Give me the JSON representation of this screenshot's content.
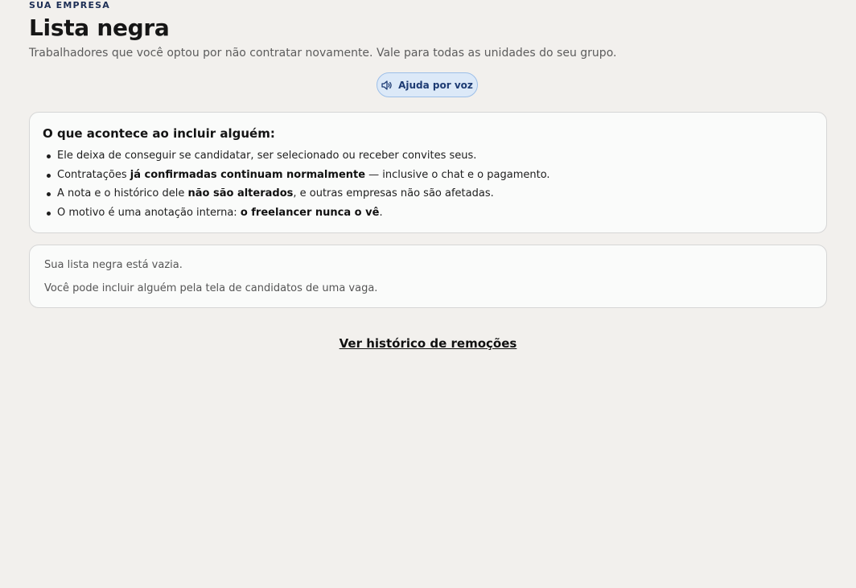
{
  "header": {
    "eyebrow": "SUA EMPRESA",
    "title": "Lista negra",
    "subtitle": "Trabalhadores que você optou por não contratar novamente. Vale para todas as unidades do seu grupo."
  },
  "voice_help": {
    "label": "Ajuda por voz",
    "icon": "speaker-icon"
  },
  "info_card": {
    "title": "O que acontece ao incluir alguém:",
    "items": [
      {
        "text": "Ele deixa de conseguir se candidatar, ser selecionado ou receber convites seus."
      },
      {
        "pre": "Contratações ",
        "bold": "já confirmadas continuam normalmente",
        "post": " — inclusive o chat e o pagamento."
      },
      {
        "pre": "A nota e o histórico dele ",
        "bold": "não são alterados",
        "post": ", e outras empresas não são afetadas."
      },
      {
        "pre": "O motivo é uma anotação interna: ",
        "bold": "o freelancer nunca o vê",
        "post": "."
      }
    ]
  },
  "empty_state": {
    "line1": "Sua lista negra está vazia.",
    "line2": "Você pode incluir alguém pela tela de candidatos de uma vaga."
  },
  "links": {
    "history": "Ver histórico de remoções"
  }
}
